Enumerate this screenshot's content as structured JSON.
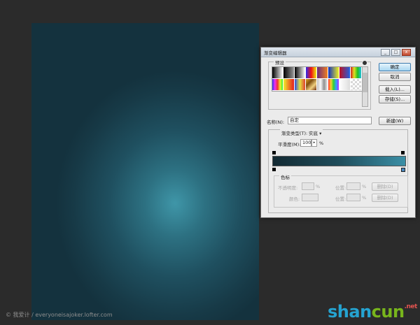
{
  "dialog": {
    "title": "渐变编辑器",
    "buttons": {
      "ok": "确定",
      "cancel": "取消",
      "load": "载入(L)...",
      "save": "存储(S)...",
      "new": "新建(W)"
    },
    "presets_legend": "预设",
    "name_label": "名称(N):",
    "name_value": "自定",
    "gradient_type_label": "渐变类型(T):",
    "gradient_type_value": "实底",
    "smoothness_label": "平滑度(M):",
    "smoothness_value": "100",
    "smoothness_unit": "%",
    "stops_legend": "色标",
    "opacity_label": "不透明度:",
    "opacity_unit": "%",
    "location_label": "位置:",
    "location_unit": "%",
    "delete_label": "删除(D)",
    "color_label": "颜色:",
    "window_buttons": {
      "minimize": "_",
      "maximize": "□",
      "close": "x"
    }
  },
  "presets": [
    "linear-gradient(to right,#000,#fff)",
    "linear-gradient(to right,#000,#999)",
    "linear-gradient(to right,#000,#fff)",
    "linear-gradient(to right,#2a2af0,#f01010,#f0f010)",
    "linear-gradient(to right,#6a2a7a,#f08020)",
    "linear-gradient(to right,#1030c0,#f0f020)",
    "linear-gradient(to right,#c01020,#2060e0)",
    "linear-gradient(to right,#d02020,#e0e020,#20c020,#20c0e0)",
    "linear-gradient(to right,#3030f0,#f030f0,#f03030,#f0f030,#30f030)",
    "linear-gradient(to right,#f0f030,#f08020,#e02020)",
    "linear-gradient(to right,#3050e0,#e0e040,#e04030)",
    "linear-gradient(135deg,#e0a020,#805010,#f0d080,#703010)",
    "linear-gradient(to right,#c0c0c0,#f8f8f8,#909090,#f0f0f0)",
    "linear-gradient(to right,#ff3030,#ffd030,#30d030,#30a0ff,#b030ff)",
    "linear-gradient(to right,#fff,#ddd)",
    "repeating-conic-gradient(#d8d8d8 0% 25%, #ffffff 0% 50%) 0 0/6px 6px"
  ],
  "watermark": "© 我爱计 / everyoneisajoker.lofter.com",
  "logo": {
    "part1": "shan",
    "part2": "cun",
    "net": ".net"
  }
}
